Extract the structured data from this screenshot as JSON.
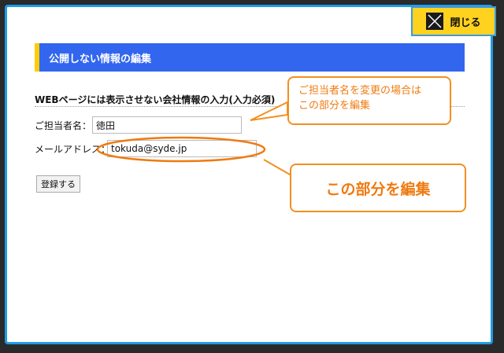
{
  "close_button": {
    "label": "閉じる",
    "icon": "close-icon"
  },
  "section": {
    "title": "公開しない情報の編集"
  },
  "form": {
    "caption": "WEBページには表示させない会社情報の入力(入力必須)",
    "contact_name_label": "ご担当者名：",
    "contact_name_value": "徳田",
    "email_label": "メールアドレス：",
    "email_value": "tokuda@syde.jp",
    "register_label": "登録する"
  },
  "annotations": {
    "callout_top_line1": "ご担当者名を変更の場合は",
    "callout_top_line2": "この部分を編集",
    "callout_bottom": "この部分を編集"
  },
  "colors": {
    "modal_border": "#1e9be6",
    "header_bg": "#3366ee",
    "header_accent": "#ffcc00",
    "close_bg": "#ffd21f",
    "callout": "#f29020"
  }
}
